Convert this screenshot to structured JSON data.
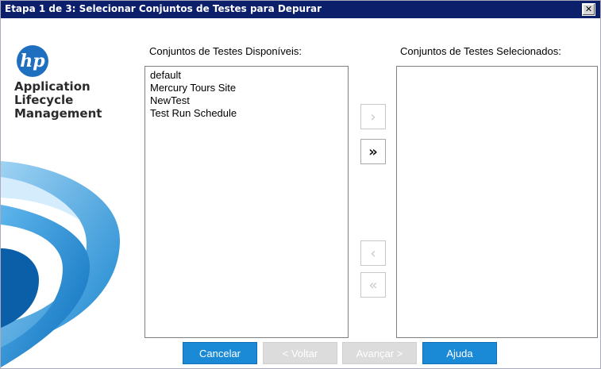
{
  "window": {
    "title": "Etapa 1 de 3: Selecionar Conjuntos de Testes para Depurar",
    "close_glyph": "✕"
  },
  "brand": {
    "logo_text": "hp",
    "product_lines": [
      "Application",
      "Lifecycle",
      "Management"
    ]
  },
  "available": {
    "label": "Conjuntos de Testes Disponíveis:",
    "items": [
      "default",
      "Mercury Tours Site",
      "NewTest",
      "Test Run Schedule"
    ]
  },
  "selected": {
    "label": "Conjuntos de Testes Selecionados:",
    "items": []
  },
  "move_buttons": {
    "add": {
      "glyph": "›",
      "enabled": false
    },
    "add_all": {
      "glyph": "»",
      "enabled": true
    },
    "remove": {
      "glyph": "‹",
      "enabled": false
    },
    "remove_all": {
      "glyph": "«",
      "enabled": false
    }
  },
  "buttons": {
    "cancel": "Cancelar",
    "back": "< Voltar",
    "next": "Avançar >",
    "help": "Ajuda"
  },
  "colors": {
    "titlebar": "#0c1f6b",
    "accent": "#1b8ad6",
    "disabled": "#dcdcdc",
    "brand_blue": "#1f6fc0"
  }
}
